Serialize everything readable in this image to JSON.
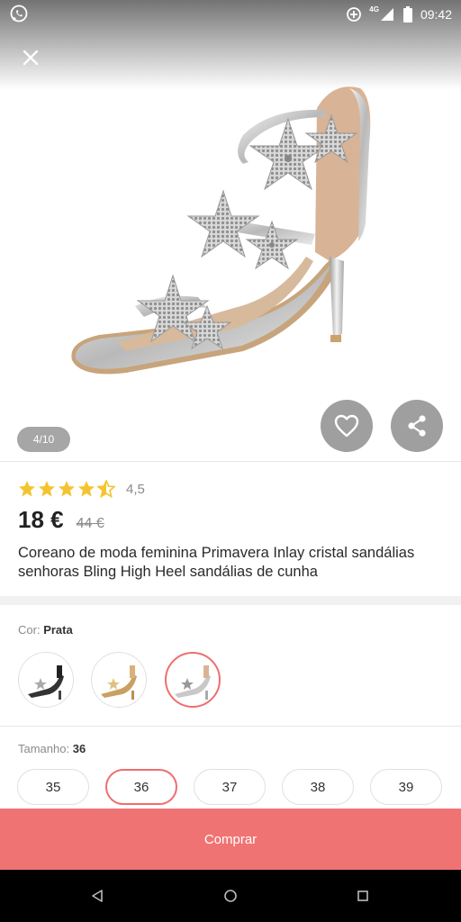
{
  "status_bar": {
    "network_label": "4G",
    "time": "09:42",
    "icons": [
      "whatsapp-icon",
      "data-saver-icon",
      "signal-icon",
      "battery-icon"
    ]
  },
  "header": {
    "close_icon": "close-icon"
  },
  "gallery": {
    "pager": "4/10",
    "favorite_icon": "heart-icon",
    "share_icon": "share-icon"
  },
  "product": {
    "rating": "4,5",
    "rating_stars": 4.5,
    "price": "18 €",
    "old_price": "44 €",
    "title": "Coreano de moda feminina Primavera Inlay cristal sandálias senhoras Bling High Heel sandálias de cunha"
  },
  "color": {
    "label": "Cor:",
    "selected": "Prata",
    "swatches": [
      "black",
      "gold",
      "silver"
    ],
    "selected_index": 2
  },
  "size": {
    "label": "Tamanho:",
    "selected": "36",
    "options": [
      "35",
      "36",
      "37",
      "38",
      "39"
    ],
    "selected_index": 1
  },
  "actions": {
    "buy_label": "Comprar"
  },
  "nav": {
    "icons": [
      "back-icon",
      "home-icon",
      "recents-icon"
    ]
  },
  "colors": {
    "accent": "#f07373",
    "selected_border": "#ef6e6e",
    "star": "#f4c430",
    "muted_text": "#8a8a8a"
  }
}
